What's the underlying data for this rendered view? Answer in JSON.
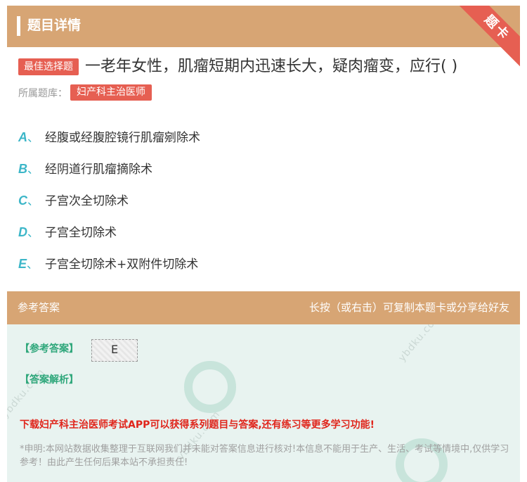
{
  "header": {
    "title": "题目详情",
    "corner_ribbon": "题卡"
  },
  "question": {
    "type_badge": "最佳选择题",
    "text": "一老年女性，肌瘤短期内迅速长大，疑肉瘤变，应行( )",
    "bank_label": "所属题库：",
    "bank_name": "妇产科主治医师"
  },
  "options": [
    {
      "letter": "A",
      "sep": "、",
      "text": "经腹或经腹腔镜行肌瘤剜除术"
    },
    {
      "letter": "B",
      "sep": "、",
      "text": "经阴道行肌瘤摘除术"
    },
    {
      "letter": "C",
      "sep": "、",
      "text": "子宫次全切除术"
    },
    {
      "letter": "D",
      "sep": "、",
      "text": "子宫全切除术"
    },
    {
      "letter": "E",
      "sep": "、",
      "text": "子宫全切除术+双附件切除术"
    }
  ],
  "answer_panel": {
    "title": "参考答案",
    "hint": "长按（或右击）可复制本题卡或分享给好友",
    "answer_label": "【参考答案】",
    "answer_value": "E",
    "analysis_label": "【答案解析】",
    "promo": "下载妇产科主治医师考试APP可以获得系列题目与答案,还有练习等更多学习功能!",
    "disclaimer": "*申明:本网站数据收集整理于互联网我们并未能对答案信息进行核对!本信息不能用于生产、生活、考试等情境中,仅供学习参考！由此产生任何后果本站不承担责任!"
  },
  "colors": {
    "header_bg": "#d7a574",
    "badge_red": "#e65f52",
    "option_letter": "#3cb6c8",
    "answer_green": "#2fa77b",
    "promo_red": "#e0251b",
    "panel_bg": "#e8f3f0"
  }
}
